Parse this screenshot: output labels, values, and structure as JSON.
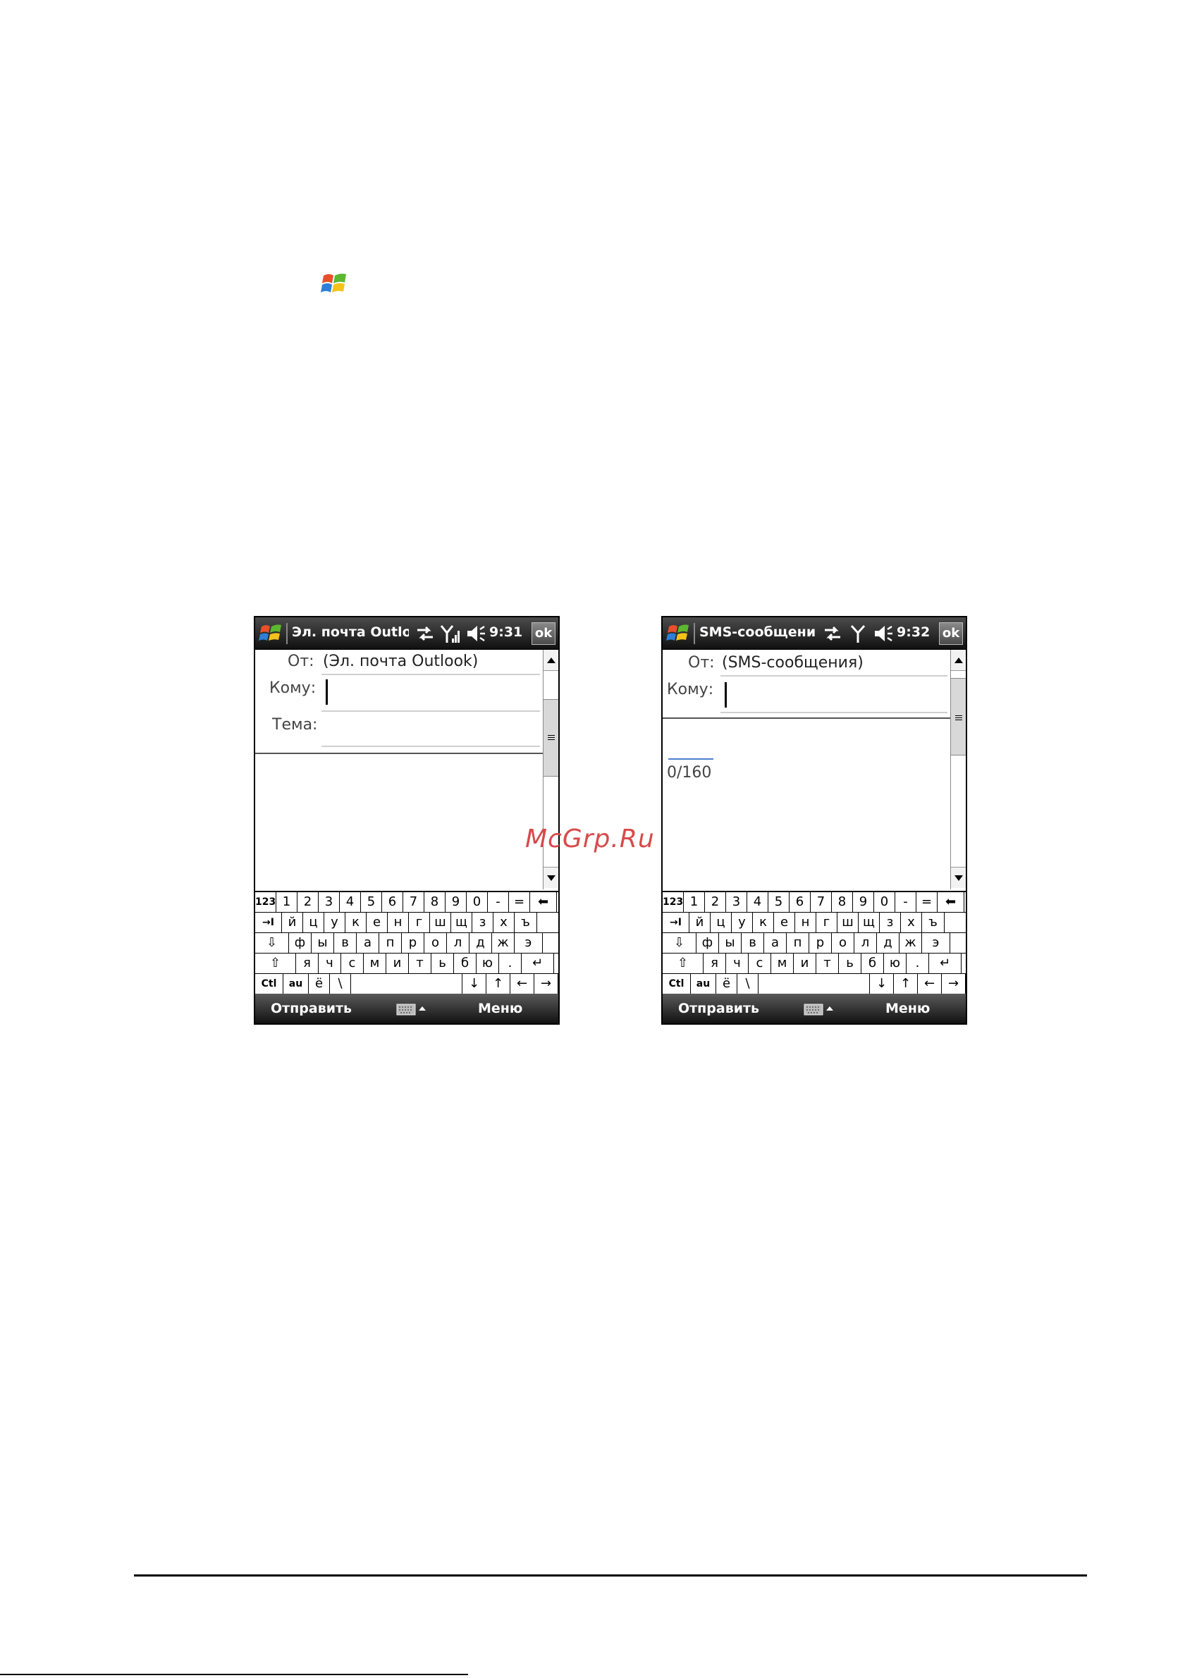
{
  "page": {
    "watermark": "McGrp.Ru"
  },
  "screens": [
    {
      "id": "outlook",
      "title": "Эл. почта Outlo",
      "time": "9:31",
      "ok_label": "ok",
      "fields": {
        "from_label": "От:",
        "from_value": "(Эл. почта Outlook)",
        "to_label": "Кому:",
        "subject_label": "Тема:"
      },
      "softkeys": {
        "left": "Отправить",
        "right": "Меню"
      }
    },
    {
      "id": "sms",
      "title": "SMS-сообщения",
      "time": "9:32",
      "ok_label": "ok",
      "fields": {
        "from_label": "От:",
        "from_value": "(SMS-сообщения)",
        "to_label": "Кому:",
        "counter": "0/160"
      },
      "softkeys": {
        "left": "Отправить",
        "right": "Меню"
      }
    }
  ],
  "keyboard": {
    "rows": [
      [
        "123",
        "1",
        "2",
        "3",
        "4",
        "5",
        "6",
        "7",
        "8",
        "9",
        "0",
        "-",
        "=",
        "⬅"
      ],
      [
        "→I",
        "й",
        "ц",
        "у",
        "к",
        "е",
        "н",
        "г",
        "ш",
        "щ",
        "з",
        "х",
        "ъ"
      ],
      [
        "⇩",
        "ф",
        "ы",
        "в",
        "а",
        "п",
        "р",
        "о",
        "л",
        "д",
        "ж",
        "э"
      ],
      [
        "⇧",
        "я",
        "ч",
        "с",
        "м",
        "и",
        "т",
        "ь",
        "б",
        "ю",
        ".",
        "↵"
      ],
      [
        "Ctl",
        "au",
        "ё",
        "\\",
        "",
        "↓",
        "↑",
        "←",
        "→"
      ]
    ]
  },
  "colors": {
    "title_bar": "#1e1e1e",
    "watermark": "#d84a4a",
    "counter_line": "#4a7fd0"
  }
}
